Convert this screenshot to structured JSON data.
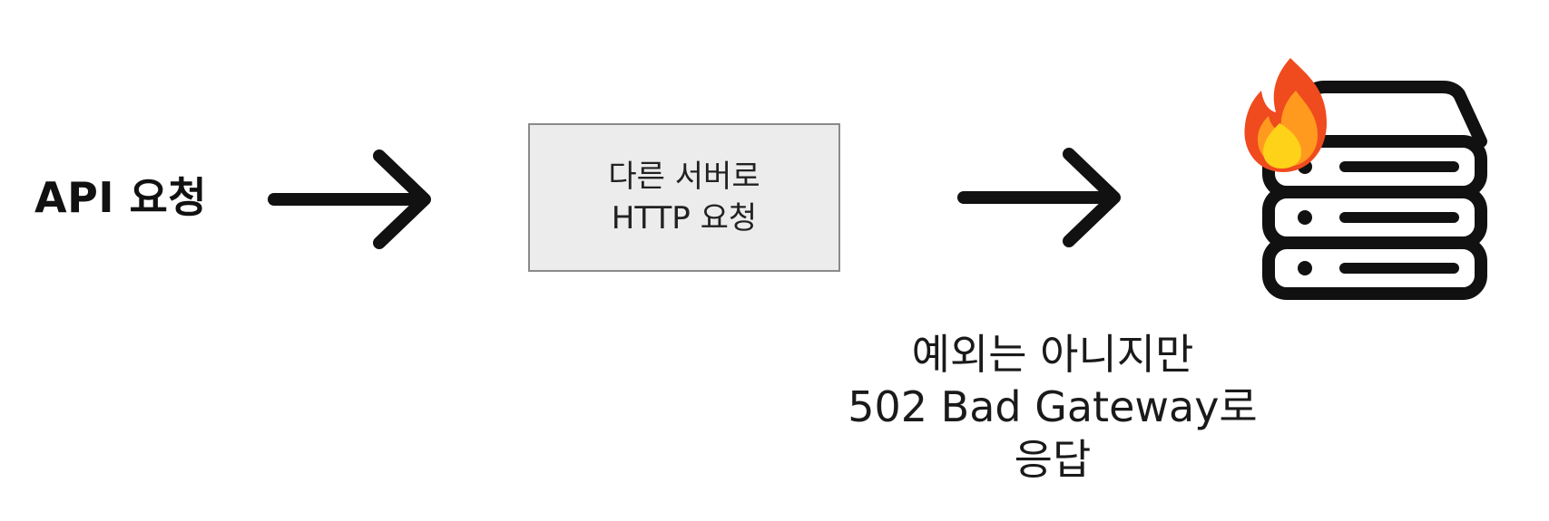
{
  "source_node": {
    "label": "API 요청"
  },
  "request_box": {
    "line1": "다른 서버로",
    "line2": "HTTP 요청"
  },
  "server": {
    "icon": "server-rack-icon",
    "status_icon": "fire-icon"
  },
  "response": {
    "line1": "예외는 아니지만",
    "line2": "502 Bad Gateway로",
    "line3": "응답"
  },
  "colors": {
    "ink": "#111111",
    "box_fill": "#ececec",
    "box_border": "#8a8a8a",
    "fire_outer": "#f04a1f",
    "fire_mid": "#ff9a1f",
    "fire_inner": "#ffd21a"
  }
}
